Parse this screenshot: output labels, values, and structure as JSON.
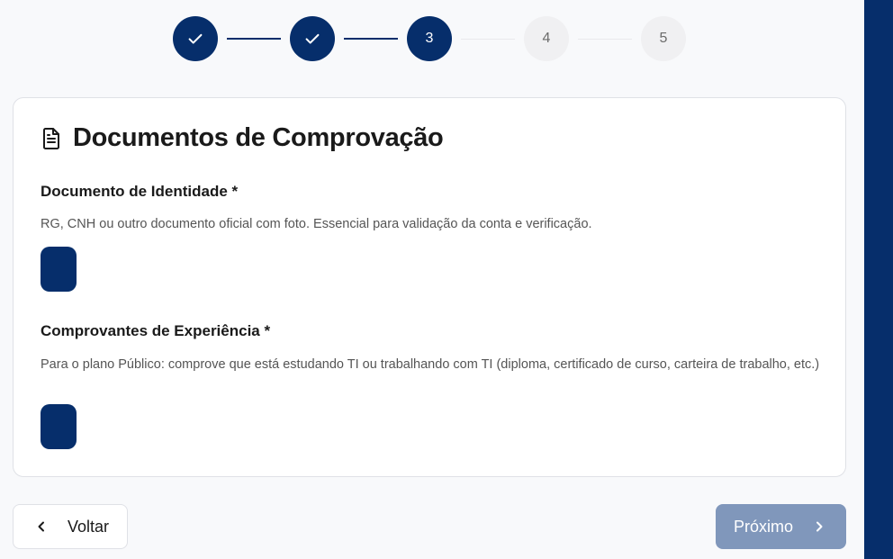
{
  "stepper": {
    "steps": [
      {
        "label": "",
        "state": "done"
      },
      {
        "label": "",
        "state": "done"
      },
      {
        "label": "3",
        "state": "active"
      },
      {
        "label": "4",
        "state": "todo"
      },
      {
        "label": "5",
        "state": "todo"
      }
    ]
  },
  "card": {
    "icon": "document-icon",
    "title": "Documentos de Comprovação",
    "sections": [
      {
        "title": "Documento de Identidade *",
        "description": "RG, CNH ou outro documento oficial com foto. Essencial para validação da conta e verificação."
      },
      {
        "title": "Comprovantes de Experiência *",
        "description": "Para o plano Público: comprove que está estudando TI ou trabalhando com TI (diploma, certificado de curso, carteira de trabalho, etc.)"
      }
    ]
  },
  "footer": {
    "back_label": "Voltar",
    "back_icon": "chevron-left-icon",
    "next_label": "Próximo",
    "next_icon": "chevron-right-icon"
  },
  "colors": {
    "primary": "#062e6b",
    "disabled_primary": "#8097bb",
    "step_inactive": "#f0f0f2"
  }
}
